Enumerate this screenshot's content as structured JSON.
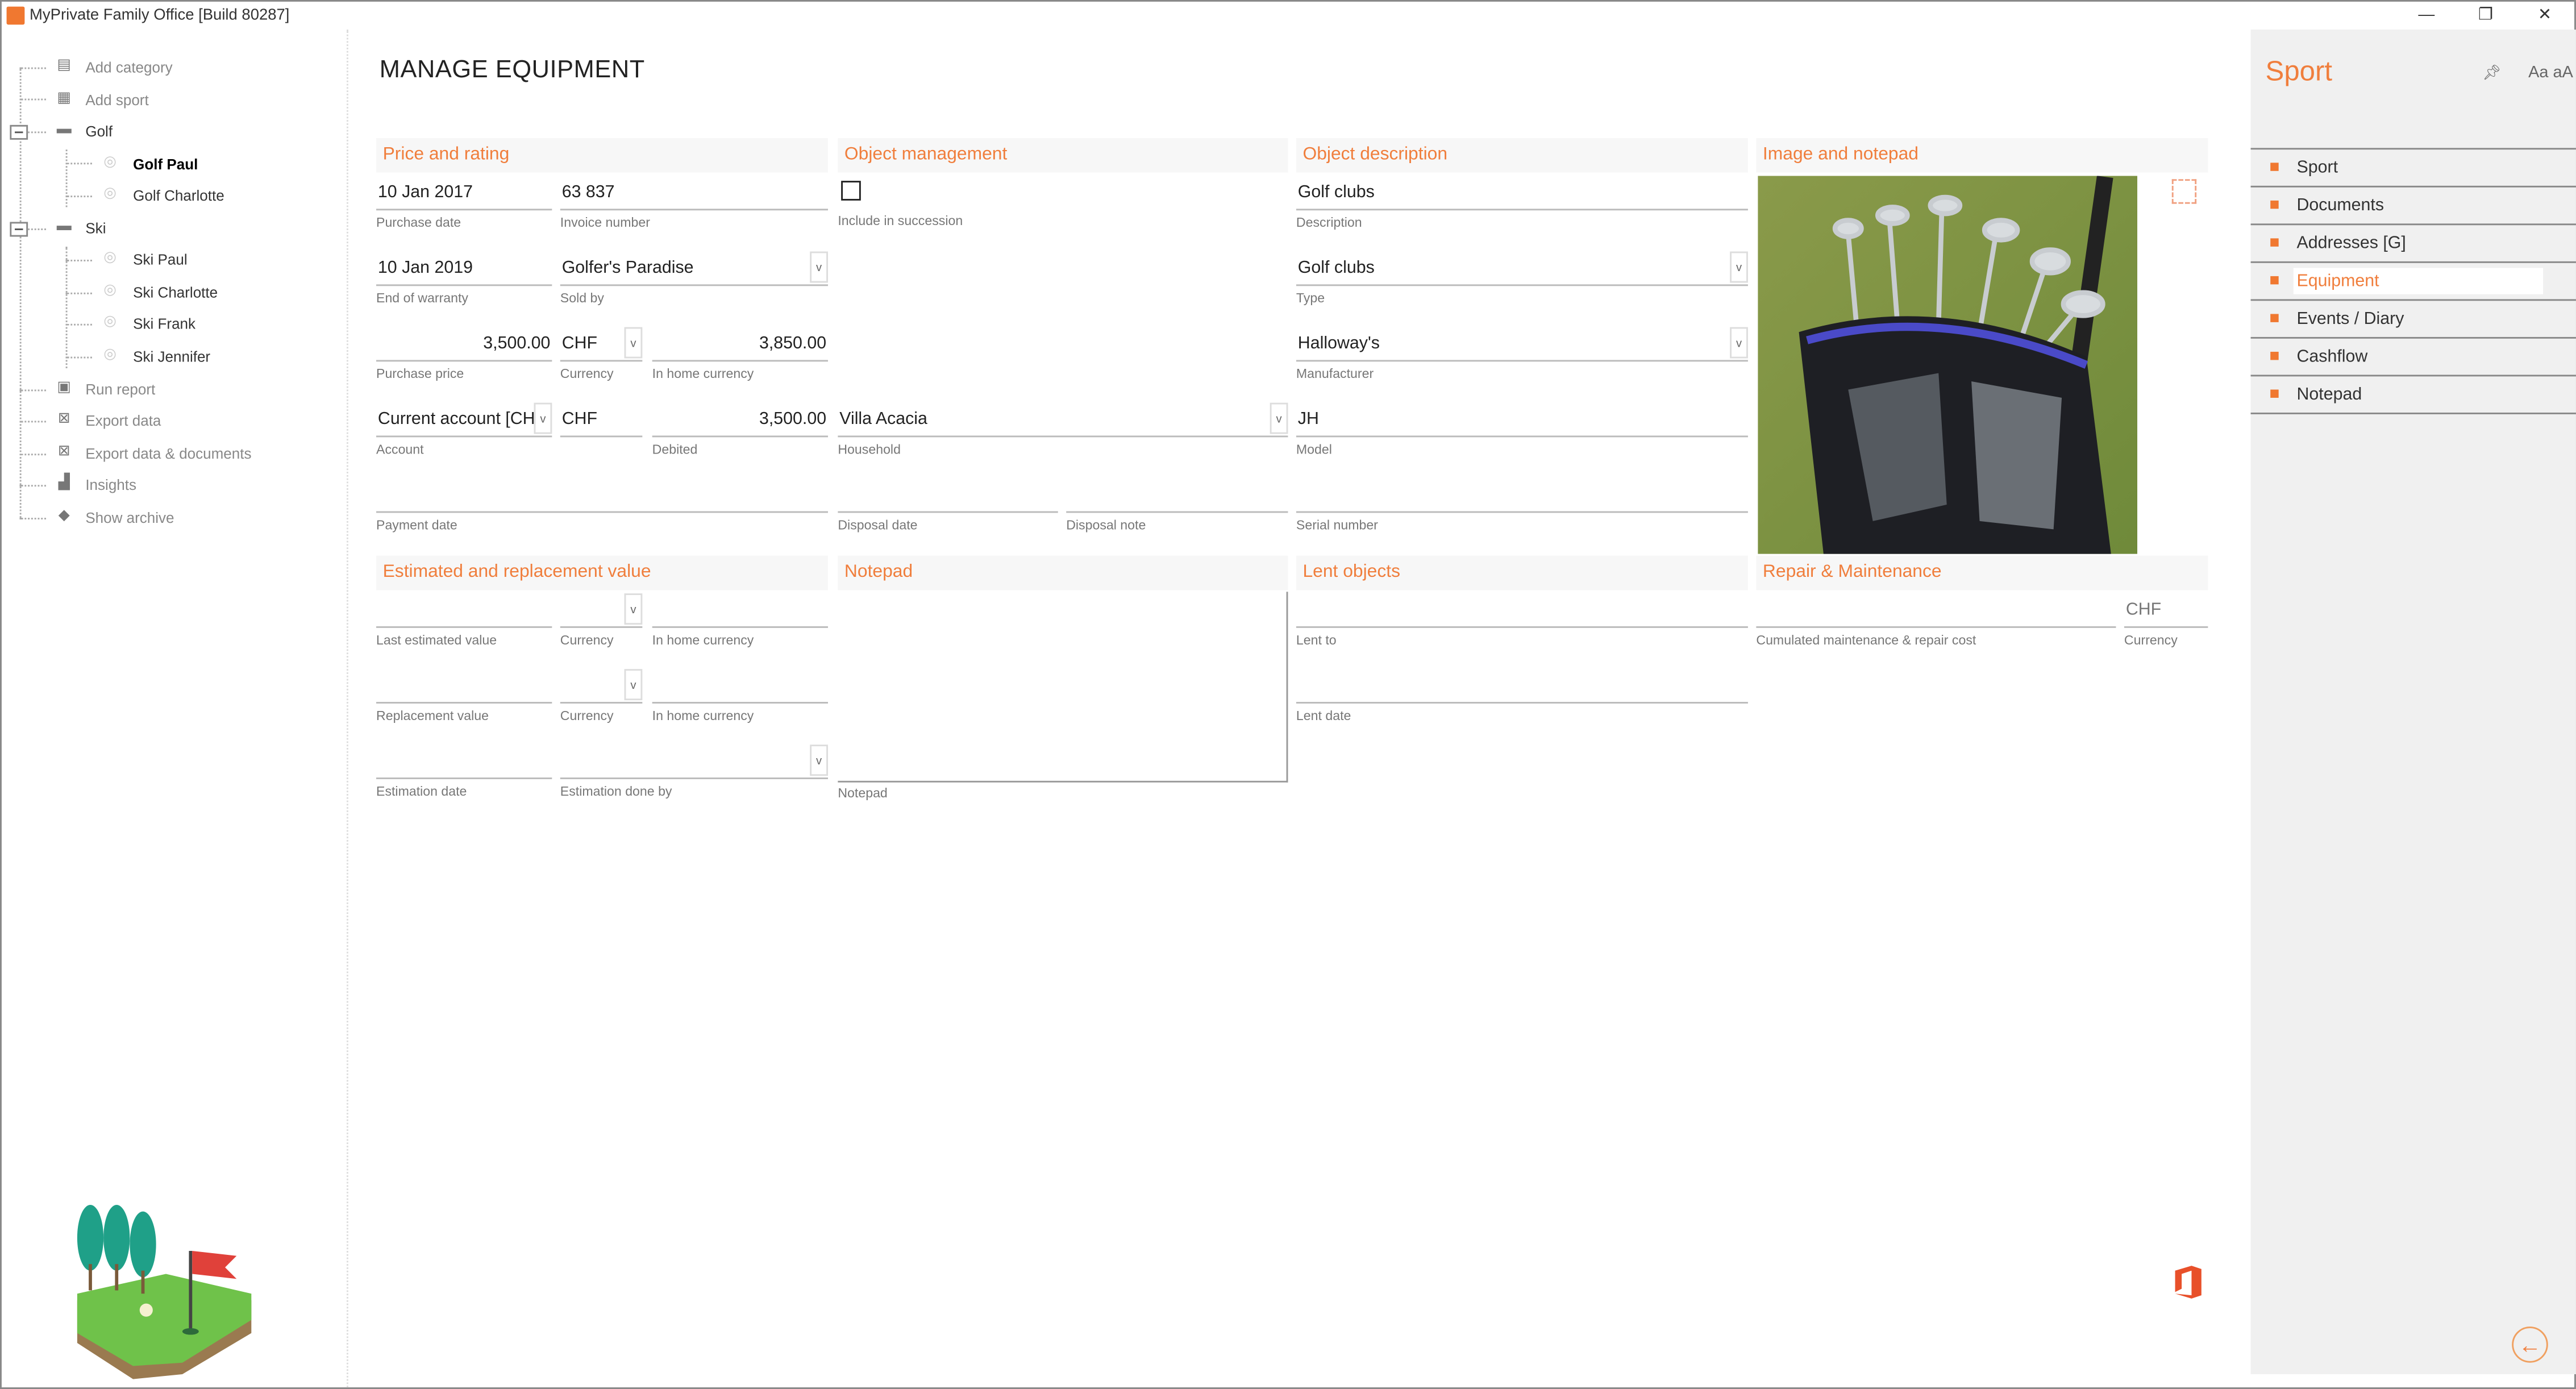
{
  "window": {
    "title": "MyPrivate Family Office [Build 80287]",
    "minimize": "—",
    "restore": "❐",
    "close": "✕"
  },
  "tree": {
    "items": [
      {
        "label": "Add category",
        "icon": "document-icon"
      },
      {
        "label": "Add sport",
        "icon": "add-sport-icon"
      },
      {
        "label": "Golf",
        "icon": "folder-icon"
      },
      {
        "label": "Golf Paul",
        "icon": "circle-icon",
        "selected": true
      },
      {
        "label": "Golf Charlotte",
        "icon": "circle-icon"
      },
      {
        "label": "Ski",
        "icon": "folder-icon"
      },
      {
        "label": "Ski Paul",
        "icon": "circle-icon"
      },
      {
        "label": "Ski Charlotte",
        "icon": "circle-icon"
      },
      {
        "label": "Ski Frank",
        "icon": "circle-icon"
      },
      {
        "label": "Ski Jennifer",
        "icon": "circle-icon"
      },
      {
        "label": "Run report",
        "icon": "report-icon"
      },
      {
        "label": "Export data",
        "icon": "excel-icon"
      },
      {
        "label": "Export data & documents",
        "icon": "excel-icon"
      },
      {
        "label": "Insights",
        "icon": "bar-chart-icon"
      },
      {
        "label": "Show archive",
        "icon": "archive-icon"
      }
    ]
  },
  "main": {
    "title": "MANAGE EQUIPMENT",
    "sections": {
      "price": "Price and rating",
      "object_mgmt": "Object management",
      "object_desc": "Object description",
      "image_notepad": "Image and notepad",
      "estimated": "Estimated and replacement value",
      "notepad": "Notepad",
      "lent": "Lent objects",
      "repair": "Repair & Maintenance"
    },
    "fields": {
      "purchase_date": {
        "label": "Purchase date",
        "value": "10 Jan 2017"
      },
      "invoice_number": {
        "label": "Invoice number",
        "value": "63 837"
      },
      "include_succession": {
        "label": "Include in succession",
        "checked": false
      },
      "description": {
        "label": "Description",
        "value": "Golf clubs"
      },
      "end_warranty": {
        "label": "End of warranty",
        "value": "10 Jan 2019"
      },
      "sold_by": {
        "label": "Sold by",
        "value": "Golfer's Paradise"
      },
      "type": {
        "label": "Type",
        "value": "Golf clubs"
      },
      "purchase_price": {
        "label": "Purchase price",
        "value": "3,500.00"
      },
      "currency": {
        "label": "Currency",
        "value": "CHF"
      },
      "home_currency": {
        "label": "In home currency",
        "value": "3,850.00"
      },
      "manufacturer": {
        "label": "Manufacturer",
        "value": "Halloway's"
      },
      "account": {
        "label": "Account",
        "value": "Current account [CH"
      },
      "account_currency": {
        "value": "CHF"
      },
      "debited": {
        "label": "Debited",
        "value": "3,500.00"
      },
      "household": {
        "label": "Household",
        "value": "Villa Acacia"
      },
      "model": {
        "label": "Model",
        "value": "JH"
      },
      "payment_date": {
        "label": "Payment date",
        "value": ""
      },
      "disposal_date": {
        "label": "Disposal date",
        "value": ""
      },
      "disposal_note": {
        "label": "Disposal note",
        "value": ""
      },
      "serial_number": {
        "label": "Serial number",
        "value": ""
      },
      "last_estimated": {
        "label": "Last estimated value",
        "value": ""
      },
      "est_currency": {
        "label": "Currency",
        "value": ""
      },
      "est_home": {
        "label": "In home currency",
        "value": ""
      },
      "notepad": {
        "label": "Notepad",
        "value": ""
      },
      "lent_to": {
        "label": "Lent to",
        "value": ""
      },
      "cumulated_cost": {
        "label": "Cumulated maintenance & repair cost",
        "value": ""
      },
      "repair_currency": {
        "label": "Currency",
        "value": "CHF"
      },
      "replacement_value": {
        "label": "Replacement value",
        "value": ""
      },
      "repl_currency": {
        "label": "Currency",
        "value": ""
      },
      "repl_home": {
        "label": "In home currency",
        "value": ""
      },
      "lent_date": {
        "label": "Lent date",
        "value": ""
      },
      "estimation_date": {
        "label": "Estimation date",
        "value": ""
      },
      "estimation_by": {
        "label": "Estimation done by",
        "value": ""
      }
    }
  },
  "right_panel": {
    "title": "Sport",
    "pin_icon": "pin-icon",
    "font_size_toggle": "Aa aA",
    "nav": [
      {
        "label": "Sport"
      },
      {
        "label": "Documents"
      },
      {
        "label": "Addresses [G]"
      },
      {
        "label": "Equipment",
        "active": true
      },
      {
        "label": "Events / Diary"
      },
      {
        "label": "Cashflow"
      },
      {
        "label": "Notepad"
      }
    ]
  },
  "colors": {
    "accent": "#f07e3c",
    "panel_bg": "#f0f0f0",
    "section_bg": "#f7f7f7"
  }
}
